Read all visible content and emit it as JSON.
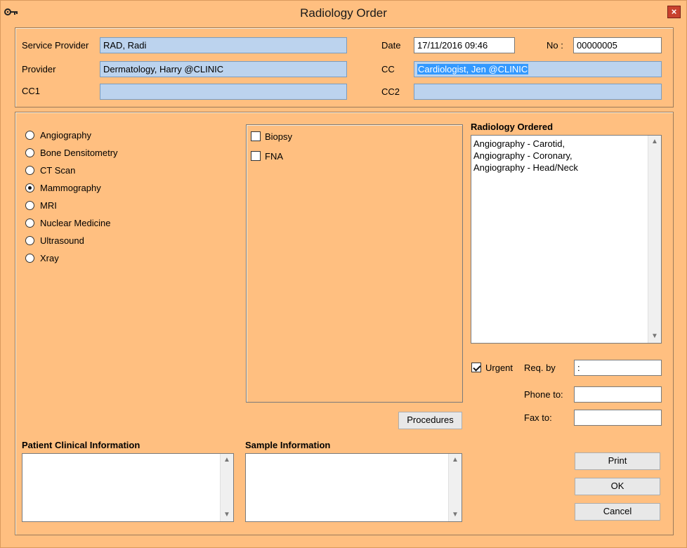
{
  "window": {
    "title": "Radiology Order",
    "close_label": "×"
  },
  "header": {
    "service_provider_label": "Service Provider",
    "service_provider_value": "RAD, Radi",
    "provider_label": "Provider",
    "provider_value": "Dermatology, Harry @CLINIC",
    "cc1_label": "CC1",
    "cc1_value": "",
    "date_label": "Date",
    "date_value": "17/11/2016 09:46",
    "no_label": "No :",
    "no_value": "00000005",
    "cc_label": "CC",
    "cc_value": "Cardiologist, Jen @CLINIC",
    "cc2_label": "CC2",
    "cc2_value": ""
  },
  "categories": [
    {
      "label": "Angiography",
      "checked": false
    },
    {
      "label": "Bone Densitometry",
      "checked": false
    },
    {
      "label": "CT Scan",
      "checked": false
    },
    {
      "label": "Mammography",
      "checked": true
    },
    {
      "label": "MRI",
      "checked": false
    },
    {
      "label": "Nuclear Medicine",
      "checked": false
    },
    {
      "label": "Ultrasound",
      "checked": false
    },
    {
      "label": "Xray",
      "checked": false
    }
  ],
  "procedures": [
    {
      "label": "Biopsy",
      "checked": false
    },
    {
      "label": "FNA",
      "checked": false
    }
  ],
  "procedures_button": "Procedures",
  "ordered": {
    "title": "Radiology Ordered",
    "items": [
      "Angiography - Carotid,",
      "Angiography - Coronary,",
      "Angiography - Head/Neck"
    ]
  },
  "urgent": {
    "label": "Urgent",
    "checked": true
  },
  "req_by": {
    "label": "Req. by",
    "value": ":"
  },
  "phone_to": {
    "label": "Phone to:",
    "value": ""
  },
  "fax_to": {
    "label": "Fax to:",
    "value": ""
  },
  "patient_info": {
    "title": "Patient Clinical Information",
    "value": ""
  },
  "sample_info": {
    "title": "Sample Information",
    "value": ""
  },
  "buttons": {
    "print": "Print",
    "ok": "OK",
    "cancel": "Cancel"
  },
  "icons": {
    "scroll_up": "▲",
    "scroll_down": "▼"
  }
}
